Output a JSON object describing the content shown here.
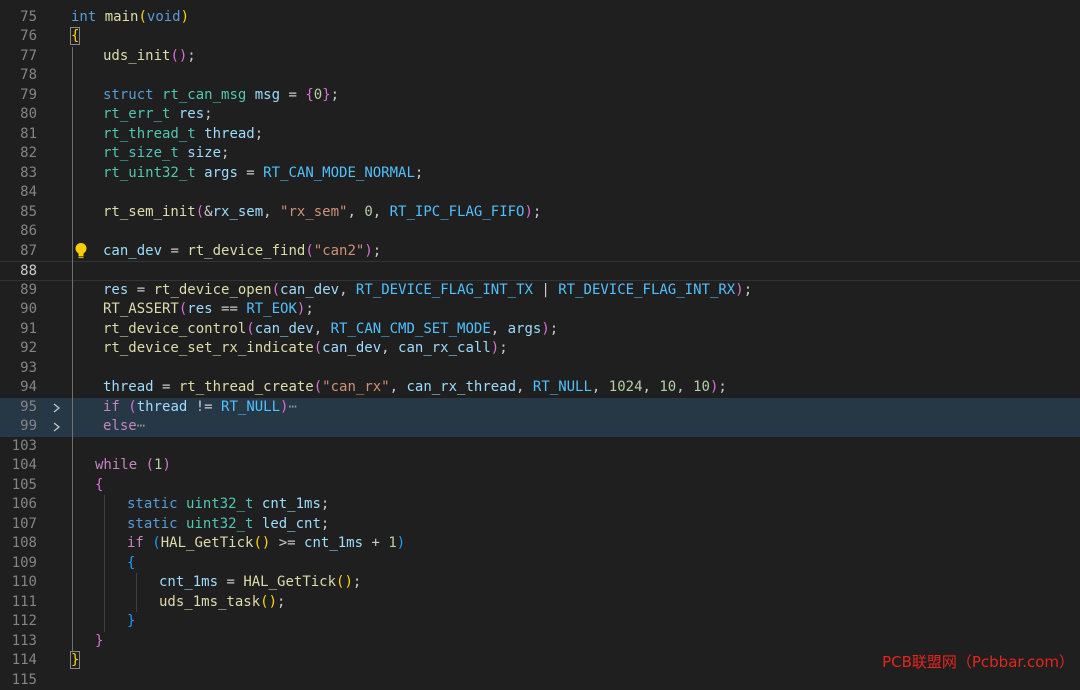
{
  "editor": {
    "lines": [
      {
        "n": "75",
        "y": 7,
        "tokens": [
          [
            "k",
            "int"
          ],
          [
            "",
            ""
          ],
          [
            "f",
            "main"
          ],
          [
            "p1",
            "("
          ],
          [
            "k",
            "void"
          ],
          [
            "p1",
            ")"
          ]
        ],
        "pre": [
          "",
          "int",
          " ",
          "main",
          "(",
          "void",
          ")"
        ]
      },
      {
        "n": "76"
      },
      {
        "n": "77"
      },
      {
        "n": "78"
      },
      {
        "n": "79"
      },
      {
        "n": "80"
      },
      {
        "n": "81"
      },
      {
        "n": "82"
      },
      {
        "n": "83"
      },
      {
        "n": "84"
      },
      {
        "n": "85"
      },
      {
        "n": "86"
      },
      {
        "n": "87"
      },
      {
        "n": "88"
      },
      {
        "n": "89"
      },
      {
        "n": "90"
      },
      {
        "n": "91"
      },
      {
        "n": "92"
      },
      {
        "n": "93"
      },
      {
        "n": "94"
      },
      {
        "n": "95"
      },
      {
        "n": "99"
      },
      {
        "n": "103"
      },
      {
        "n": "104"
      },
      {
        "n": "105"
      },
      {
        "n": "106"
      },
      {
        "n": "107"
      },
      {
        "n": "108"
      },
      {
        "n": "109"
      },
      {
        "n": "110"
      },
      {
        "n": "111"
      },
      {
        "n": "112"
      },
      {
        "n": "113"
      },
      {
        "n": "114"
      },
      {
        "n": "115"
      }
    ]
  },
  "code": [
    {
      "n": "75",
      "ind": 0,
      "tok": [
        [
          "k",
          "int"
        ],
        [
          "",
          " "
        ],
        [
          "f",
          "main"
        ],
        [
          "p1",
          "("
        ],
        [
          "k",
          "void"
        ],
        [
          "p1",
          ")"
        ]
      ]
    },
    {
      "n": "76",
      "ind": 0,
      "tok": [
        [
          "p1 bm",
          "{"
        ]
      ]
    },
    {
      "n": "77",
      "ind": 1,
      "tok": [
        [
          "f",
          "uds_init"
        ],
        [
          "p2",
          "()"
        ],
        [
          "",
          ";"
        ]
      ]
    },
    {
      "n": "78",
      "ind": 0,
      "tok": []
    },
    {
      "n": "79",
      "ind": 1,
      "tok": [
        [
          "k",
          "struct"
        ],
        [
          "",
          " "
        ],
        [
          "t",
          "rt_can_msg"
        ],
        [
          "",
          " "
        ],
        [
          "v",
          "msg"
        ],
        [
          "",
          " = "
        ],
        [
          "p2",
          "{"
        ],
        [
          "n",
          "0"
        ],
        [
          "p2",
          "}"
        ],
        [
          "",
          ";"
        ]
      ]
    },
    {
      "n": "80",
      "ind": 1,
      "tok": [
        [
          "t",
          "rt_err_t"
        ],
        [
          "",
          " "
        ],
        [
          "v",
          "res"
        ],
        [
          "",
          ";"
        ]
      ]
    },
    {
      "n": "81",
      "ind": 1,
      "tok": [
        [
          "t",
          "rt_thread_t"
        ],
        [
          "",
          " "
        ],
        [
          "v",
          "thread"
        ],
        [
          "",
          ";"
        ]
      ]
    },
    {
      "n": "82",
      "ind": 1,
      "tok": [
        [
          "t",
          "rt_size_t"
        ],
        [
          "",
          " "
        ],
        [
          "v",
          "size"
        ],
        [
          "",
          ";"
        ]
      ]
    },
    {
      "n": "83",
      "ind": 1,
      "tok": [
        [
          "t",
          "rt_uint32_t"
        ],
        [
          "",
          " "
        ],
        [
          "v",
          "args"
        ],
        [
          "",
          " = "
        ],
        [
          "m",
          "RT_CAN_MODE_NORMAL"
        ],
        [
          "",
          ";"
        ]
      ]
    },
    {
      "n": "84",
      "ind": 0,
      "tok": []
    },
    {
      "n": "85",
      "ind": 1,
      "tok": [
        [
          "f",
          "rt_sem_init"
        ],
        [
          "p2",
          "("
        ],
        [
          "",
          "&"
        ],
        [
          "v",
          "rx_sem"
        ],
        [
          "",
          ", "
        ],
        [
          "s",
          "\"rx_sem\""
        ],
        [
          "",
          ", "
        ],
        [
          "n",
          "0"
        ],
        [
          "",
          ", "
        ],
        [
          "m",
          "RT_IPC_FLAG_FIFO"
        ],
        [
          "p2",
          ")"
        ],
        [
          "",
          ";"
        ]
      ]
    },
    {
      "n": "86",
      "ind": 0,
      "tok": []
    },
    {
      "n": "87",
      "ind": 1,
      "bulb": true,
      "tok": [
        [
          "v",
          "can_dev"
        ],
        [
          "",
          " = "
        ],
        [
          "f",
          "rt_device_find"
        ],
        [
          "p2",
          "("
        ],
        [
          "s",
          "\"can2\""
        ],
        [
          "p2",
          ")"
        ],
        [
          "",
          ";"
        ]
      ]
    },
    {
      "n": "88",
      "ind": 0,
      "cur": true,
      "tok": []
    },
    {
      "n": "89",
      "ind": 1,
      "tok": [
        [
          "v",
          "res"
        ],
        [
          "",
          " = "
        ],
        [
          "f",
          "rt_device_open"
        ],
        [
          "p2",
          "("
        ],
        [
          "v",
          "can_dev"
        ],
        [
          "",
          ", "
        ],
        [
          "m",
          "RT_DEVICE_FLAG_INT_TX"
        ],
        [
          "",
          " | "
        ],
        [
          "m",
          "RT_DEVICE_FLAG_INT_RX"
        ],
        [
          "p2",
          ")"
        ],
        [
          "",
          ";"
        ]
      ]
    },
    {
      "n": "90",
      "ind": 1,
      "tok": [
        [
          "f",
          "RT_ASSERT"
        ],
        [
          "p2",
          "("
        ],
        [
          "v",
          "res"
        ],
        [
          "",
          " == "
        ],
        [
          "m",
          "RT_EOK"
        ],
        [
          "p2",
          ")"
        ],
        [
          "",
          ";"
        ]
      ]
    },
    {
      "n": "91",
      "ind": 1,
      "tok": [
        [
          "f",
          "rt_device_control"
        ],
        [
          "p2",
          "("
        ],
        [
          "v",
          "can_dev"
        ],
        [
          "",
          ", "
        ],
        [
          "m",
          "RT_CAN_CMD_SET_MODE"
        ],
        [
          "",
          ", "
        ],
        [
          "v",
          "args"
        ],
        [
          "p2",
          ")"
        ],
        [
          "",
          ";"
        ]
      ]
    },
    {
      "n": "92",
      "ind": 1,
      "tok": [
        [
          "f",
          "rt_device_set_rx_indicate"
        ],
        [
          "p2",
          "("
        ],
        [
          "v",
          "can_dev"
        ],
        [
          "",
          ", "
        ],
        [
          "v",
          "can_rx_call"
        ],
        [
          "p2",
          ")"
        ],
        [
          "",
          ";"
        ]
      ]
    },
    {
      "n": "93",
      "ind": 0,
      "tok": []
    },
    {
      "n": "94",
      "ind": 1,
      "tok": [
        [
          "v",
          "thread"
        ],
        [
          "",
          " = "
        ],
        [
          "f",
          "rt_thread_create"
        ],
        [
          "p2",
          "("
        ],
        [
          "s",
          "\"can_rx\""
        ],
        [
          "",
          ", "
        ],
        [
          "v",
          "can_rx_thread"
        ],
        [
          "",
          ", "
        ],
        [
          "m",
          "RT_NULL"
        ],
        [
          "",
          ", "
        ],
        [
          "n",
          "1024"
        ],
        [
          "",
          ", "
        ],
        [
          "n",
          "10"
        ],
        [
          "",
          ", "
        ],
        [
          "n",
          "10"
        ],
        [
          "p2",
          ")"
        ],
        [
          "",
          ";"
        ]
      ]
    },
    {
      "n": "95",
      "ind": 1,
      "hl": true,
      "fold": true,
      "tok": [
        [
          "c",
          "if"
        ],
        [
          "",
          " "
        ],
        [
          "p2",
          "("
        ],
        [
          "v",
          "thread"
        ],
        [
          "",
          " != "
        ],
        [
          "m",
          "RT_NULL"
        ],
        [
          "p2",
          ")"
        ],
        [
          "dim",
          "⋯"
        ]
      ]
    },
    {
      "n": "99",
      "ind": 1,
      "hl": true,
      "fold": true,
      "tok": [
        [
          "c",
          "else"
        ],
        [
          "dim",
          "⋯"
        ]
      ]
    },
    {
      "n": "103",
      "ind": 0,
      "tok": []
    },
    {
      "n": "104",
      "ind": 0.75,
      "tok": [
        [
          "c",
          "while"
        ],
        [
          "",
          " "
        ],
        [
          "p2",
          "("
        ],
        [
          "n",
          "1"
        ],
        [
          "p2",
          ")"
        ]
      ]
    },
    {
      "n": "105",
      "ind": 0.75,
      "tok": [
        [
          "p2",
          "{"
        ]
      ]
    },
    {
      "n": "106",
      "ind": 1.75,
      "tok": [
        [
          "k",
          "static"
        ],
        [
          "",
          " "
        ],
        [
          "t",
          "uint32_t"
        ],
        [
          "",
          " "
        ],
        [
          "v",
          "cnt_1ms"
        ],
        [
          "",
          ";"
        ]
      ]
    },
    {
      "n": "107",
      "ind": 1.75,
      "tok": [
        [
          "k",
          "static"
        ],
        [
          "",
          " "
        ],
        [
          "t",
          "uint32_t"
        ],
        [
          "",
          " "
        ],
        [
          "v",
          "led_cnt"
        ],
        [
          "",
          ";"
        ]
      ]
    },
    {
      "n": "108",
      "ind": 1.75,
      "tok": [
        [
          "c",
          "if"
        ],
        [
          "",
          " "
        ],
        [
          "p3",
          "("
        ],
        [
          "f",
          "HAL_GetTick"
        ],
        [
          "p1",
          "()"
        ],
        [
          "",
          " >= "
        ],
        [
          "v",
          "cnt_1ms"
        ],
        [
          "",
          " + "
        ],
        [
          "n",
          "1"
        ],
        [
          "p3",
          ")"
        ]
      ]
    },
    {
      "n": "109",
      "ind": 1.75,
      "tok": [
        [
          "p3",
          "{"
        ]
      ]
    },
    {
      "n": "110",
      "ind": 2.75,
      "tok": [
        [
          "v",
          "cnt_1ms"
        ],
        [
          "",
          " = "
        ],
        [
          "f",
          "HAL_GetTick"
        ],
        [
          "p1",
          "()"
        ],
        [
          "",
          ";"
        ]
      ]
    },
    {
      "n": "111",
      "ind": 2.75,
      "tok": [
        [
          "f",
          "uds_1ms_task"
        ],
        [
          "p1",
          "()"
        ],
        [
          "",
          ";"
        ]
      ]
    },
    {
      "n": "112",
      "ind": 1.75,
      "tok": [
        [
          "p3",
          "}"
        ]
      ]
    },
    {
      "n": "113",
      "ind": 0.75,
      "tok": [
        [
          "p2",
          "}"
        ]
      ]
    },
    {
      "n": "114",
      "ind": 0,
      "tok": [
        [
          "p1 bm",
          "}"
        ]
      ]
    },
    {
      "n": "115",
      "ind": 0,
      "tok": []
    }
  ],
  "watermark": "PCB联盟网（Pcbbar.com）"
}
